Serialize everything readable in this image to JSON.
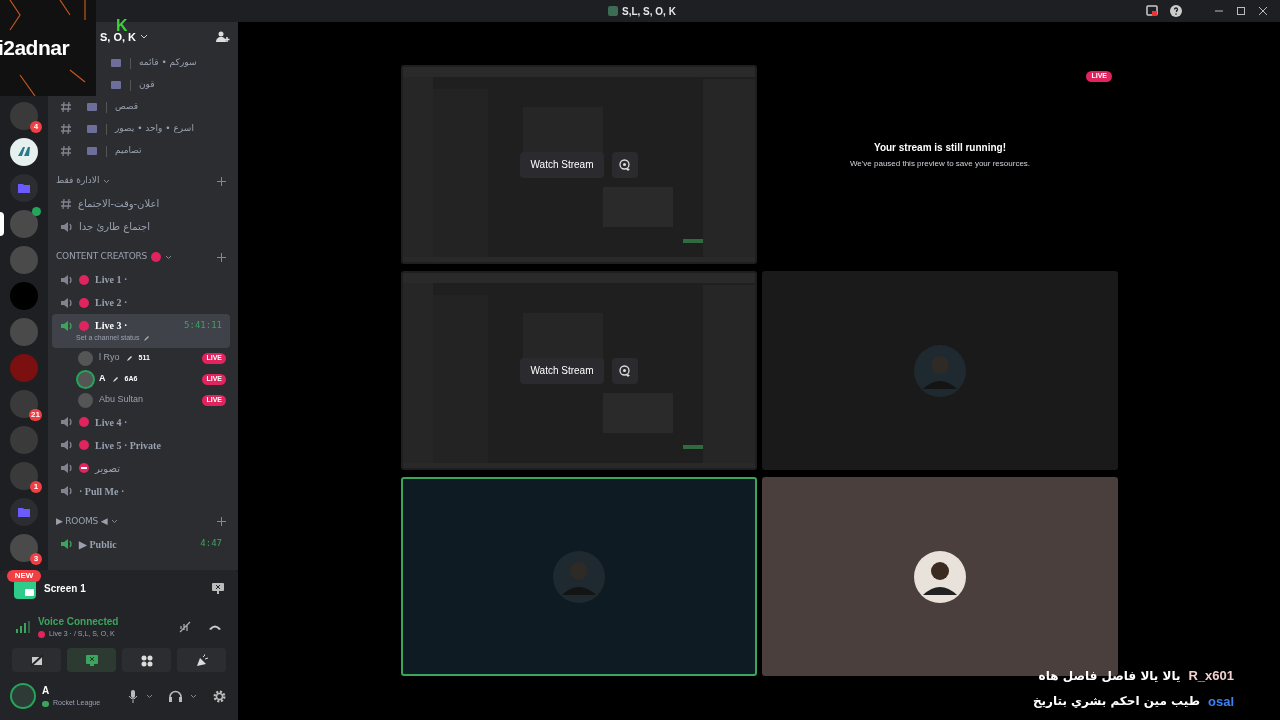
{
  "title_bar": {
    "title": "S,L, S, O, K"
  },
  "stream_overlay": {
    "logo_text": "i2adnar"
  },
  "servers": [
    {
      "badge": "4",
      "selected": false,
      "kind": "grid"
    },
    {
      "selected": false,
      "kind": "round"
    },
    {
      "selected": false,
      "kind": "folder"
    },
    {
      "selected": true,
      "kind": "avatar"
    },
    {
      "selected": false,
      "kind": "avatar"
    },
    {
      "selected": false,
      "kind": "dark"
    },
    {
      "selected": false,
      "kind": "avatar"
    },
    {
      "selected": false,
      "kind": "red"
    },
    {
      "badge": "21",
      "selected": false,
      "kind": "grid"
    },
    {
      "selected": false,
      "kind": "grid"
    },
    {
      "badge": "1",
      "selected": false,
      "kind": "grid"
    },
    {
      "selected": false,
      "kind": "folder"
    },
    {
      "badge": "3",
      "selected": false,
      "kind": "avatar"
    }
  ],
  "new_badge": "NEW",
  "server_header": {
    "name": "S, O, K",
    "logo": "K"
  },
  "channels": [
    {
      "kind": "text",
      "name": "سوركم • قائمه"
    },
    {
      "kind": "text",
      "name": "قون"
    },
    {
      "kind": "text",
      "name": "قصص"
    },
    {
      "kind": "text",
      "name": "اسرع • واحد • يصور"
    },
    {
      "kind": "text",
      "name": "تصاميم"
    }
  ],
  "categories": [
    {
      "name": "الادارة فقط",
      "channels": [
        {
          "kind": "text",
          "name": "اعلان-وقت-الاجتماع",
          "selected": false
        },
        {
          "kind": "voice",
          "name": "اجتماع طارئ جدا",
          "selected": false,
          "connected": false
        }
      ]
    },
    {
      "name": "CONTENT CREATORS",
      "marker": {
        "kind": "dot",
        "color": "#e0245e"
      },
      "channels": [
        {
          "kind": "voice",
          "marker": {
            "kind": "dot",
            "color": "#e0245e"
          },
          "name": "Live 1 ·",
          "selected": false,
          "connected": false
        },
        {
          "kind": "voice",
          "marker": {
            "kind": "dot",
            "color": "#e0245e"
          },
          "name": "Live 2 ·",
          "selected": false,
          "connected": false
        },
        {
          "kind": "voice",
          "marker": {
            "kind": "dot",
            "color": "#e0245e"
          },
          "name": "Live 3 ·",
          "selected": true,
          "connected": true,
          "timer": "5:41:11",
          "status": "Set a channel status",
          "users": [
            {
              "name": "l Ryo",
              "tag": "511",
              "badge": "LIVE",
              "speaking": false
            },
            {
              "name": "A",
              "tag": "6A6",
              "badge": "LIVE",
              "speaking": true
            },
            {
              "name": "Abu Sultan",
              "badge": "LIVE",
              "speaking": false
            }
          ]
        },
        {
          "kind": "voice",
          "marker": {
            "kind": "dot",
            "color": "#e0245e"
          },
          "name": "Live 4 ·",
          "selected": false,
          "connected": false
        },
        {
          "kind": "voice",
          "marker": {
            "kind": "dot",
            "color": "#e0245e"
          },
          "name": "Live 5 · Private",
          "selected": false,
          "connected": false
        },
        {
          "kind": "voice",
          "marker": {
            "kind": "no-entry",
            "color": "#e0245e"
          },
          "name": "تصوير",
          "selected": false,
          "connected": false
        },
        {
          "kind": "voice",
          "name": "· Pull Me ·",
          "selected": false,
          "connected": false
        }
      ]
    },
    {
      "name": "▶ ROOMS ◀",
      "channels": [
        {
          "kind": "voice",
          "name": "▶ Public",
          "selected": false,
          "connected": true,
          "timer": "4:47"
        }
      ]
    }
  ],
  "screen_share": {
    "title": "Screen 1"
  },
  "voice": {
    "status": "Voice Connected",
    "channel": "Live 3 · / S,L, S, O, K"
  },
  "voice_controls": [
    {
      "kind": "camera",
      "selected": false
    },
    {
      "kind": "screen",
      "selected": true
    },
    {
      "kind": "activity",
      "selected": false
    },
    {
      "kind": "soundboard",
      "selected": false
    }
  ],
  "user": {
    "name": "A",
    "activity": "Rocket League"
  },
  "tiles": [
    {
      "kind": "stream",
      "button": "Watch Stream",
      "speaking": false
    },
    {
      "kind": "paused",
      "badge": "LIVE",
      "title": "Your stream is still running!",
      "message": "We've paused this preview to save your resources.",
      "speaking": false
    },
    {
      "kind": "stream",
      "button": "Watch Stream",
      "speaking": false
    },
    {
      "kind": "camera-off",
      "speaking": false
    },
    {
      "kind": "camera-off",
      "speaking": true
    },
    {
      "kind": "camera-off",
      "speaking": false
    }
  ],
  "overlay_chat": [
    {
      "user": "R_x601",
      "text": "يالا يالا فاصل فاصل هاه",
      "color": "#f2d0d0"
    },
    {
      "user": "osal",
      "text": "طيب مين احكم بشري بتاريخ",
      "color": "#3b82f6"
    }
  ]
}
